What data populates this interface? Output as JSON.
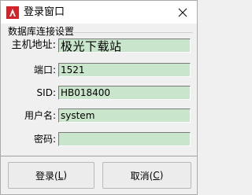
{
  "window": {
    "title": "登录窗口",
    "close_glyph": "✕",
    "icon": "app-logo-icon"
  },
  "group": {
    "title": "数据库连接设置"
  },
  "fields": {
    "host": {
      "label": "主机地址:",
      "value": "极光下载站"
    },
    "port": {
      "label": "端口:",
      "value": "1521"
    },
    "sid": {
      "label": "SID:",
      "value": "HB018400"
    },
    "username": {
      "label": "用户名:",
      "value": "system"
    },
    "password": {
      "label": "密码:",
      "value": ""
    }
  },
  "buttons": {
    "login_prefix": "登录(",
    "login_hotkey": "L",
    "login_suffix": ")",
    "cancel_prefix": "取消(",
    "cancel_hotkey": "C",
    "cancel_suffix": ")"
  },
  "colors": {
    "field_bg": "#c9e6cc",
    "logo_red": "#d2232a"
  }
}
